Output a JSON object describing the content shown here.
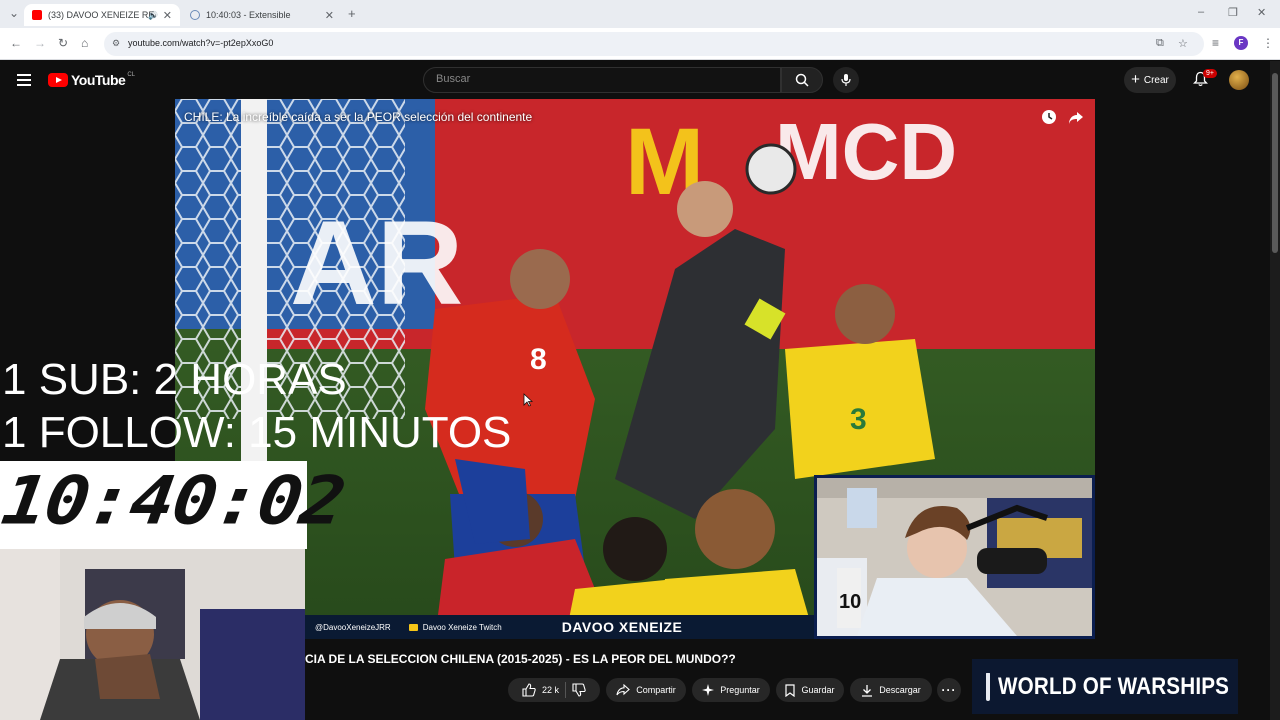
{
  "browser": {
    "tabs": [
      {
        "title": "(33) DAVOO XENEIZE REAC...",
        "active": true
      },
      {
        "title": "10:40:03 - Extensible",
        "active": false
      }
    ],
    "url": "youtube.com/watch?v=-pt2epXxoG0"
  },
  "youtube": {
    "logo_text": "YouTube",
    "logo_region": "CL",
    "search_placeholder": "Buscar",
    "create_label": "Crear",
    "notif_count": "9+"
  },
  "player": {
    "title": "CHILE: La increíble caída a ser la PEOR selección del continente",
    "handle": "@DavooXeneizeJRR",
    "twitch_label": "Davoo Xeneize Twitch",
    "brand": "DAVOO XENEIZE"
  },
  "stream_overlay": {
    "line1": "1 SUB: 2 HORAS",
    "line2": "1 FOLLOW: 15 MINUTOS",
    "timer": "10:40:02"
  },
  "video": {
    "title": "CIA DE LA SELECCION CHILENA (2015-2025) - ES LA PEOR DEL MUNDO??",
    "likes": "22 k",
    "share_label": "Compartir",
    "ask_label": "Preguntar",
    "save_label": "Guardar",
    "download_label": "Descargar"
  },
  "ad": {
    "text": "WORLD OF WARSHIPS"
  },
  "colors": {
    "yt_red": "#ff0000",
    "bg": "#0f0f0f",
    "chile_red": "#d52b1e",
    "brazil_yellow": "#f2d21c"
  }
}
